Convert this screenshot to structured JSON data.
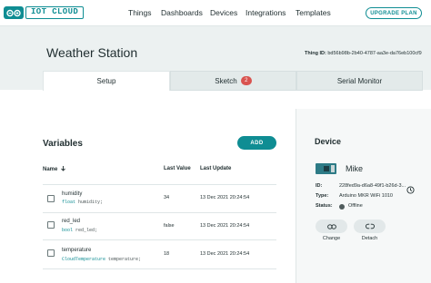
{
  "brand": {
    "name": "IOT CLOUD",
    "color": "#0f8d93"
  },
  "nav": {
    "items": [
      {
        "label": "Things"
      },
      {
        "label": "Dashboards"
      },
      {
        "label": "Devices"
      },
      {
        "label": "Integrations"
      },
      {
        "label": "Templates"
      }
    ],
    "upgrade_label": "UPGRADE PLAN"
  },
  "thing": {
    "title": "Weather Station",
    "id_label": "Thing ID:",
    "id_value": "bd56b98b-2b40-4787-aa3e-da76eb100cf9"
  },
  "tabs": [
    {
      "label": "Setup",
      "active": true
    },
    {
      "label": "Sketch",
      "badge": "2",
      "active": false
    },
    {
      "label": "Serial Monitor",
      "active": false
    }
  ],
  "variables": {
    "title": "Variables",
    "add_label": "ADD",
    "columns": {
      "name": "Name",
      "sort_icon": "arrow-down-icon",
      "last_value": "Last Value",
      "last_update": "Last Update"
    },
    "rows": [
      {
        "name": "humidity",
        "type": "float",
        "ident": "humidity;",
        "value": "34",
        "updated": "13 Dec 2021 20:24:54"
      },
      {
        "name": "red_led",
        "type": "bool",
        "ident": "red_led;",
        "value": "false",
        "updated": "13 Dec 2021 20:24:54"
      },
      {
        "name": "temperature",
        "type": "CloudTemperature",
        "ident": "temperature;",
        "value": "18",
        "updated": "13 Dec 2021 20:24:54"
      }
    ]
  },
  "device": {
    "title": "Device",
    "name": "Mike",
    "id_label": "ID:",
    "id_value": "228fed9a-d6a8-49f1-b26d-3...",
    "type_label": "Type:",
    "type_value": "Arduino MKR WiFi 1010",
    "status_label": "Status:",
    "status_value": "Offline",
    "change_label": "Change",
    "detach_label": "Detach"
  }
}
